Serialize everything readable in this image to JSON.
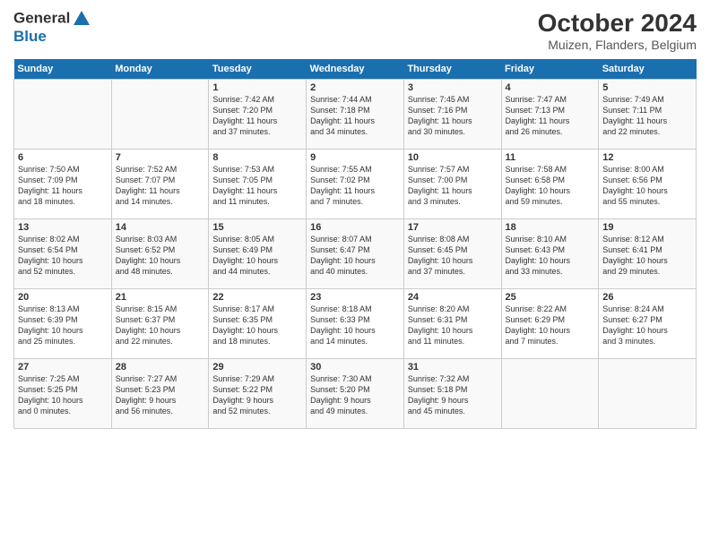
{
  "logo": {
    "line1": "General",
    "line2": "Blue"
  },
  "title": "October 2024",
  "subtitle": "Muizen, Flanders, Belgium",
  "days_of_week": [
    "Sunday",
    "Monday",
    "Tuesday",
    "Wednesday",
    "Thursday",
    "Friday",
    "Saturday"
  ],
  "weeks": [
    [
      {
        "num": "",
        "info": ""
      },
      {
        "num": "",
        "info": ""
      },
      {
        "num": "1",
        "info": "Sunrise: 7:42 AM\nSunset: 7:20 PM\nDaylight: 11 hours\nand 37 minutes."
      },
      {
        "num": "2",
        "info": "Sunrise: 7:44 AM\nSunset: 7:18 PM\nDaylight: 11 hours\nand 34 minutes."
      },
      {
        "num": "3",
        "info": "Sunrise: 7:45 AM\nSunset: 7:16 PM\nDaylight: 11 hours\nand 30 minutes."
      },
      {
        "num": "4",
        "info": "Sunrise: 7:47 AM\nSunset: 7:13 PM\nDaylight: 11 hours\nand 26 minutes."
      },
      {
        "num": "5",
        "info": "Sunrise: 7:49 AM\nSunset: 7:11 PM\nDaylight: 11 hours\nand 22 minutes."
      }
    ],
    [
      {
        "num": "6",
        "info": "Sunrise: 7:50 AM\nSunset: 7:09 PM\nDaylight: 11 hours\nand 18 minutes."
      },
      {
        "num": "7",
        "info": "Sunrise: 7:52 AM\nSunset: 7:07 PM\nDaylight: 11 hours\nand 14 minutes."
      },
      {
        "num": "8",
        "info": "Sunrise: 7:53 AM\nSunset: 7:05 PM\nDaylight: 11 hours\nand 11 minutes."
      },
      {
        "num": "9",
        "info": "Sunrise: 7:55 AM\nSunset: 7:02 PM\nDaylight: 11 hours\nand 7 minutes."
      },
      {
        "num": "10",
        "info": "Sunrise: 7:57 AM\nSunset: 7:00 PM\nDaylight: 11 hours\nand 3 minutes."
      },
      {
        "num": "11",
        "info": "Sunrise: 7:58 AM\nSunset: 6:58 PM\nDaylight: 10 hours\nand 59 minutes."
      },
      {
        "num": "12",
        "info": "Sunrise: 8:00 AM\nSunset: 6:56 PM\nDaylight: 10 hours\nand 55 minutes."
      }
    ],
    [
      {
        "num": "13",
        "info": "Sunrise: 8:02 AM\nSunset: 6:54 PM\nDaylight: 10 hours\nand 52 minutes."
      },
      {
        "num": "14",
        "info": "Sunrise: 8:03 AM\nSunset: 6:52 PM\nDaylight: 10 hours\nand 48 minutes."
      },
      {
        "num": "15",
        "info": "Sunrise: 8:05 AM\nSunset: 6:49 PM\nDaylight: 10 hours\nand 44 minutes."
      },
      {
        "num": "16",
        "info": "Sunrise: 8:07 AM\nSunset: 6:47 PM\nDaylight: 10 hours\nand 40 minutes."
      },
      {
        "num": "17",
        "info": "Sunrise: 8:08 AM\nSunset: 6:45 PM\nDaylight: 10 hours\nand 37 minutes."
      },
      {
        "num": "18",
        "info": "Sunrise: 8:10 AM\nSunset: 6:43 PM\nDaylight: 10 hours\nand 33 minutes."
      },
      {
        "num": "19",
        "info": "Sunrise: 8:12 AM\nSunset: 6:41 PM\nDaylight: 10 hours\nand 29 minutes."
      }
    ],
    [
      {
        "num": "20",
        "info": "Sunrise: 8:13 AM\nSunset: 6:39 PM\nDaylight: 10 hours\nand 25 minutes."
      },
      {
        "num": "21",
        "info": "Sunrise: 8:15 AM\nSunset: 6:37 PM\nDaylight: 10 hours\nand 22 minutes."
      },
      {
        "num": "22",
        "info": "Sunrise: 8:17 AM\nSunset: 6:35 PM\nDaylight: 10 hours\nand 18 minutes."
      },
      {
        "num": "23",
        "info": "Sunrise: 8:18 AM\nSunset: 6:33 PM\nDaylight: 10 hours\nand 14 minutes."
      },
      {
        "num": "24",
        "info": "Sunrise: 8:20 AM\nSunset: 6:31 PM\nDaylight: 10 hours\nand 11 minutes."
      },
      {
        "num": "25",
        "info": "Sunrise: 8:22 AM\nSunset: 6:29 PM\nDaylight: 10 hours\nand 7 minutes."
      },
      {
        "num": "26",
        "info": "Sunrise: 8:24 AM\nSunset: 6:27 PM\nDaylight: 10 hours\nand 3 minutes."
      }
    ],
    [
      {
        "num": "27",
        "info": "Sunrise: 7:25 AM\nSunset: 5:25 PM\nDaylight: 10 hours\nand 0 minutes."
      },
      {
        "num": "28",
        "info": "Sunrise: 7:27 AM\nSunset: 5:23 PM\nDaylight: 9 hours\nand 56 minutes."
      },
      {
        "num": "29",
        "info": "Sunrise: 7:29 AM\nSunset: 5:22 PM\nDaylight: 9 hours\nand 52 minutes."
      },
      {
        "num": "30",
        "info": "Sunrise: 7:30 AM\nSunset: 5:20 PM\nDaylight: 9 hours\nand 49 minutes."
      },
      {
        "num": "31",
        "info": "Sunrise: 7:32 AM\nSunset: 5:18 PM\nDaylight: 9 hours\nand 45 minutes."
      },
      {
        "num": "",
        "info": ""
      },
      {
        "num": "",
        "info": ""
      }
    ]
  ]
}
